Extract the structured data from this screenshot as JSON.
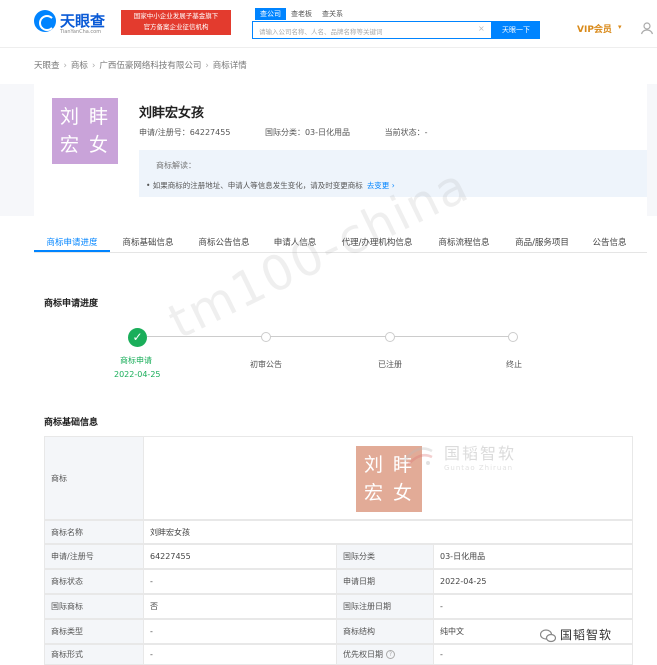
{
  "header": {
    "logo_text": "天眼查",
    "logo_sub": "TianYanCha.com",
    "gov_badge_line1": "国家中小企业发展子基金旗下",
    "gov_badge_line2": "官方备案企业征信机构",
    "search_tabs": [
      "查公司",
      "查老板",
      "查关系"
    ],
    "search_placeholder": "请输入公司名称、人名、品牌名称等关键词",
    "search_clear": "×",
    "search_button": "天眼一下",
    "vip_label": "VIP会员",
    "vip_dropdown": "▾"
  },
  "breadcrumb": [
    "天眼查",
    "商标",
    "广西伍豪网络科技有限公司",
    "商标详情"
  ],
  "summary": {
    "thumb_text_line1": "刘 盽",
    "thumb_text_line2": "宏 女",
    "title": "刘盽宏女孩",
    "reg_no": "申请/注册号：64227455",
    "intl_class": "国际分类：03-日化用品",
    "status": "当前状态：-",
    "notice_title": "商标解读：",
    "notice_text": "• 如果商标的注册地址、申请人等信息发生变化，请及时变更商标",
    "notice_link": "去变更 ›"
  },
  "tabs": [
    "商标申请进度",
    "商标基础信息",
    "商标公告信息",
    "申请人信息",
    "代理/办理机构信息",
    "商标流程信息",
    "商品/服务项目",
    "公告信息"
  ],
  "progress": {
    "section_title": "商标申请进度",
    "steps": [
      {
        "label": "商标申请",
        "date": "2022-04-25"
      },
      {
        "label": "初审公告",
        "date": ""
      },
      {
        "label": "已注册",
        "date": ""
      },
      {
        "label": "终止",
        "date": ""
      }
    ]
  },
  "basic": {
    "section_title": "商标基础信息",
    "trademark_label": "商标",
    "image_line1": "刘 盽",
    "image_line2": "宏 女",
    "name_label": "商标名称",
    "name_value": "刘盽宏女孩",
    "rows": [
      {
        "l1": "申请/注册号",
        "v1": "64227455",
        "l2": "国际分类",
        "v2": "03-日化用品"
      },
      {
        "l1": "商标状态",
        "v1": "-",
        "l2": "申请日期",
        "v2": "2022-04-25"
      },
      {
        "l1": "国际商标",
        "v1": "否",
        "l2": "国际注册日期",
        "v2": "-"
      },
      {
        "l1": "商标类型",
        "v1": "-",
        "l2": "商标结构",
        "v2": "纯中文"
      },
      {
        "l1": "商标形式",
        "v1": "-",
        "l2": "优先权日期",
        "v2": "-"
      }
    ]
  },
  "watermarks": {
    "diagonal": "tm100-china",
    "brand_cn": "国韬智软",
    "brand_en": "Guntao Zhiruan",
    "wechat_text": "国韬智软"
  },
  "colors": {
    "primary": "#0084ff",
    "success": "#1aae5a",
    "thumb_purple": "#c9a3d9",
    "thumb_salmon": "#e2ab97"
  }
}
